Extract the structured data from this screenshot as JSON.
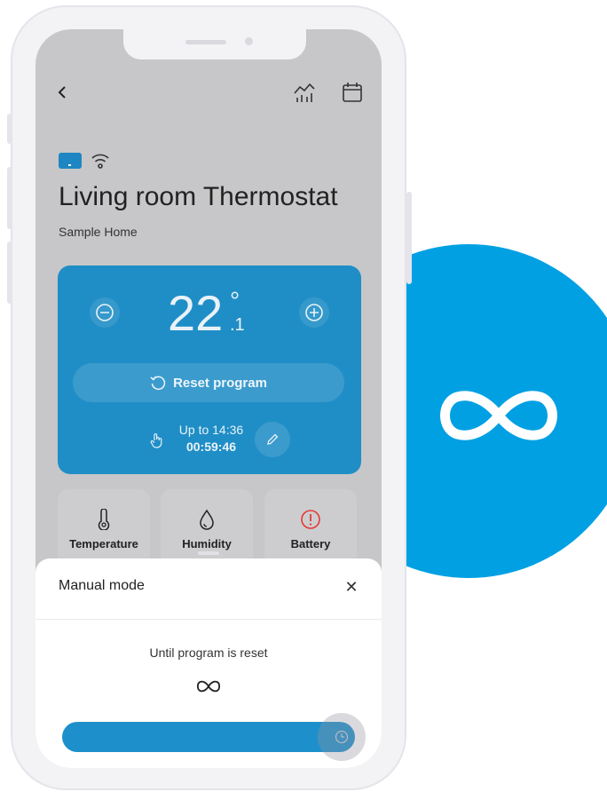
{
  "header": {
    "back_icon": "chevron-left-icon",
    "stats_icon": "chart-icon",
    "calendar_icon": "calendar-icon"
  },
  "device": {
    "type_icon": "thermostat-device-icon",
    "connection_icon": "wifi-icon",
    "name": "Living room Thermostat",
    "home": "Sample Home"
  },
  "control": {
    "temperature_whole": "22",
    "temperature_decimal": ".1",
    "degree_symbol": "°",
    "decrease_icon": "minus-circle-icon",
    "increase_icon": "plus-circle-icon",
    "reset_label": "Reset program",
    "reset_icon": "reset-icon",
    "until_label": "Up to 14:36",
    "countdown": "00:59:46",
    "hand_icon": "hand-icon",
    "edit_icon": "pencil-icon"
  },
  "tiles": [
    {
      "label": "Temperature",
      "icon": "thermometer-icon"
    },
    {
      "label": "Humidity",
      "icon": "droplet-icon"
    },
    {
      "label": "Battery",
      "icon": "alert-icon",
      "icon_color": "#e53935"
    }
  ],
  "sheet": {
    "title": "Manual mode",
    "close_symbol": "✕",
    "description": "Until program is reset",
    "duration_icon": "infinity-icon",
    "slider_icon": "clock-icon"
  },
  "colors": {
    "brand_blue": "#00a0e3",
    "card_blue": "#208ec6",
    "alert_red": "#e53935"
  }
}
